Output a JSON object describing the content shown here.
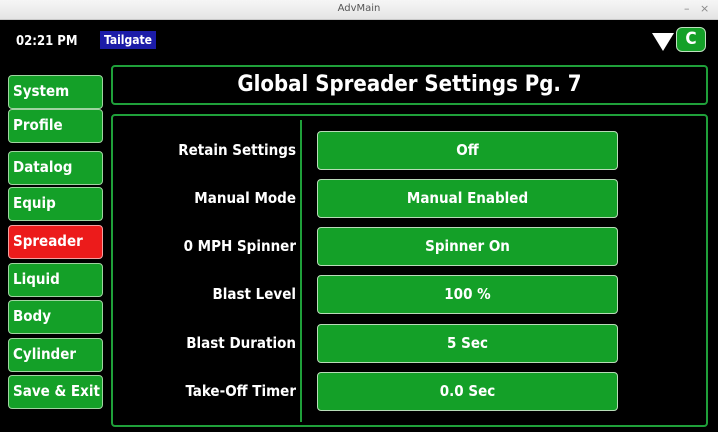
{
  "window": {
    "title": "AdvMain",
    "minimize": "–",
    "close": "×"
  },
  "status": {
    "time": "02:21 PM",
    "tailgate": "Tailgate",
    "c_button": "C"
  },
  "nav": [
    {
      "label": "System"
    },
    {
      "label": "Profile"
    },
    {
      "label": "Datalog"
    },
    {
      "label": "Equip"
    },
    {
      "label": "Spreader",
      "active": true
    },
    {
      "label": "Liquid"
    },
    {
      "label": "Body"
    },
    {
      "label": "Cylinder"
    },
    {
      "label": "Save & Exit"
    }
  ],
  "page": {
    "title": "Global Spreader Settings Pg. 7"
  },
  "settings": [
    {
      "label": "Retain Settings",
      "value": "Off"
    },
    {
      "label": "Manual Mode",
      "value": "Manual Enabled"
    },
    {
      "label": "0 MPH Spinner",
      "value": "Spinner On"
    },
    {
      "label": "Blast Level",
      "value": "100 %"
    },
    {
      "label": "Blast Duration",
      "value": "5 Sec"
    },
    {
      "label": "Take-Off Timer",
      "value": "0.0 Sec"
    }
  ],
  "colors": {
    "button_green": "#14a028",
    "active_red": "#ec1b1b",
    "border_green": "#1fa03a",
    "tailgate_blue": "#1c1ca8"
  }
}
